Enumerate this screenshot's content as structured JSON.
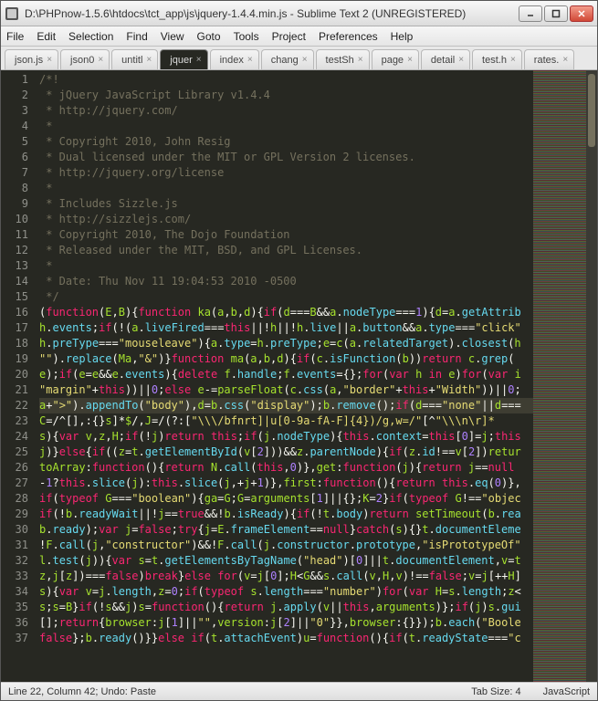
{
  "window": {
    "title": "D:\\PHPnow-1.5.6\\htdocs\\tct_app\\js\\jquery-1.4.4.min.js - Sublime Text 2 (UNREGISTERED)"
  },
  "menu": {
    "items": [
      "File",
      "Edit",
      "Selection",
      "Find",
      "View",
      "Goto",
      "Tools",
      "Project",
      "Preferences",
      "Help"
    ]
  },
  "tabs": {
    "items": [
      {
        "label": "json.js",
        "active": false
      },
      {
        "label": "json0",
        "active": false
      },
      {
        "label": "untitl",
        "active": false
      },
      {
        "label": "jquer",
        "active": true
      },
      {
        "label": "index",
        "active": false
      },
      {
        "label": "chang",
        "active": false
      },
      {
        "label": "testSh",
        "active": false
      },
      {
        "label": "page",
        "active": false
      },
      {
        "label": "detail",
        "active": false
      },
      {
        "label": "test.h",
        "active": false
      },
      {
        "label": "rates.",
        "active": false
      }
    ]
  },
  "code": {
    "first_line": 1,
    "highlight_line": 22,
    "lines": [
      "/*!",
      " * jQuery JavaScript Library v1.4.4",
      " * http://jquery.com/",
      " *",
      " * Copyright 2010, John Resig",
      " * Dual licensed under the MIT or GPL Version 2 licenses.",
      " * http://jquery.org/license",
      " *",
      " * Includes Sizzle.js",
      " * http://sizzlejs.com/",
      " * Copyright 2010, The Dojo Foundation",
      " * Released under the MIT, BSD, and GPL Licenses.",
      " *",
      " * Date: Thu Nov 11 19:04:53 2010 -0500",
      " */",
      "(function(E,B){function ka(a,b,d){if(d===B&&a.nodeType===1){d=a.getAttrib",
      "h.events;if(!(a.liveFired===this||!h||!h.live||a.button&&a.type===\"click\"",
      "h.preType===\"mouseleave\"){a.type=h.preType;e=c(a.relatedTarget).closest(h",
      "\"\").replace(Ma,\"&\")}function ma(a,b,d){if(c.isFunction(b))return c.grep(",
      "e);if(e=e&&e.events){delete f.handle;f.events={};for(var h in e)for(var i",
      "\"margin\"+this))||0;else e-=parseFloat(c.css(a,\"border\"+this+\"Width\"))||0;",
      "a+\">\").appendTo(\"body\"),d=b.css(\"display\");b.remove();if(d===\"none\"||d===",
      "C=/^[\\],:{}\\s]*$/,J=/\\\\(?:[\"\\\\\\/bfnrt]|u[0-9a-fA-F]{4})/g,w=/\"[^\"\\\\\\n\\r]*",
      "s){var v,z,H;if(!j)return this;if(j.nodeType){this.context=this[0]=j;this",
      "j)}else{if((z=t.getElementById(v[2]))&&z.parentNode){if(z.id!==v[2])retur",
      "toArray:function(){return N.call(this,0)},get:function(j){return j==null",
      "-1?this.slice(j):this.slice(j,+j+1)},first:function(){return this.eq(0)},",
      "if(typeof G===\"boolean\"){ga=G;G=arguments[1]||{};K=2}if(typeof G!==\"objec",
      "if(!b.readyWait||!j==true&&!b.isReady){if(!t.body)return setTimeout(b.rea",
      "b.ready);var j=false;try{j=E.frameElement==null}catch(s){}t.documentEleme",
      "!F.call(j,\"constructor\")&&!F.call(j.constructor.prototype,\"isPrototypeOf\"",
      "l.test(j)){var s=t.getElementsByTagName(\"head\")[0]||t.documentElement,v=t",
      "z,j[z])===false)break}else for(v=j[0];H<G&&s.call(v,H,v)!==false;v=j[++H]",
      "s){var v=j.length,z=0;if(typeof s.length===\"number\")for(var H=s.length;z<",
      "s;s=B}if(!s&&j)s=function(){return j.apply(v||this,arguments)};if(j)s.gui",
      "[];return{browser:j[1]||\"\",version:j[2]||\"0\"}},browser:{}});b.each(\"Boole",
      "false};b.ready()}}else if(t.attachEvent)u=function(){if(t.readyState===\"c"
    ]
  },
  "status": {
    "left": "Line 22, Column 42; Undo: Paste",
    "tab_size": "Tab Size: 4",
    "syntax": "JavaScript"
  }
}
